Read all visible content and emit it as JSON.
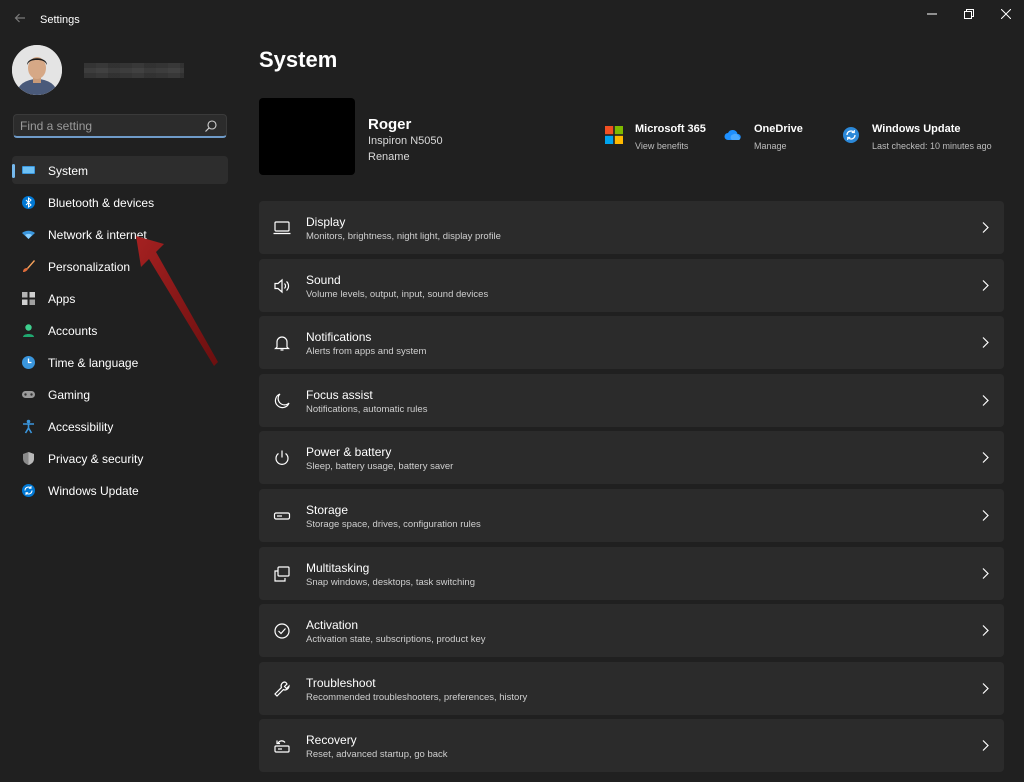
{
  "window": {
    "title": "Settings"
  },
  "profile": {
    "name_redacted": true
  },
  "search": {
    "placeholder": "Find a setting",
    "value": ""
  },
  "sidebar": {
    "items": [
      {
        "label": "System",
        "icon": "system-icon",
        "selected": true
      },
      {
        "label": "Bluetooth & devices",
        "icon": "bluetooth-icon",
        "selected": false
      },
      {
        "label": "Network & internet",
        "icon": "wifi-icon",
        "selected": false
      },
      {
        "label": "Personalization",
        "icon": "brush-icon",
        "selected": false
      },
      {
        "label": "Apps",
        "icon": "apps-icon",
        "selected": false
      },
      {
        "label": "Accounts",
        "icon": "person-icon",
        "selected": false
      },
      {
        "label": "Time & language",
        "icon": "globe-clock-icon",
        "selected": false
      },
      {
        "label": "Gaming",
        "icon": "gamepad-icon",
        "selected": false
      },
      {
        "label": "Accessibility",
        "icon": "accessibility-icon",
        "selected": false
      },
      {
        "label": "Privacy & security",
        "icon": "shield-icon",
        "selected": false
      },
      {
        "label": "Windows Update",
        "icon": "sync-icon",
        "selected": false
      }
    ]
  },
  "main": {
    "title": "System",
    "device": {
      "name": "Roger",
      "model": "Inspiron N5050",
      "rename": "Rename"
    },
    "quick_links": [
      {
        "title": "Microsoft 365",
        "subtitle": "View benefits",
        "icon": "microsoft-logo-icon"
      },
      {
        "title": "OneDrive",
        "subtitle": "Manage",
        "icon": "cloud-icon"
      },
      {
        "title": "Windows Update",
        "subtitle": "Last checked: 10 minutes ago",
        "icon": "update-icon"
      }
    ],
    "cards": [
      {
        "title": "Display",
        "subtitle": "Monitors, brightness, night light, display profile",
        "icon": "monitor-icon"
      },
      {
        "title": "Sound",
        "subtitle": "Volume levels, output, input, sound devices",
        "icon": "speaker-icon"
      },
      {
        "title": "Notifications",
        "subtitle": "Alerts from apps and system",
        "icon": "bell-icon"
      },
      {
        "title": "Focus assist",
        "subtitle": "Notifications, automatic rules",
        "icon": "moon-icon"
      },
      {
        "title": "Power & battery",
        "subtitle": "Sleep, battery usage, battery saver",
        "icon": "power-icon"
      },
      {
        "title": "Storage",
        "subtitle": "Storage space, drives, configuration rules",
        "icon": "drive-icon"
      },
      {
        "title": "Multitasking",
        "subtitle": "Snap windows, desktops, task switching",
        "icon": "multitask-icon"
      },
      {
        "title": "Activation",
        "subtitle": "Activation state, subscriptions, product key",
        "icon": "check-circle-icon"
      },
      {
        "title": "Troubleshoot",
        "subtitle": "Recommended troubleshooters, preferences, history",
        "icon": "wrench-icon"
      },
      {
        "title": "Recovery",
        "subtitle": "Reset, advanced startup, go back",
        "icon": "recovery-icon"
      }
    ]
  },
  "colors": {
    "background": "#202020",
    "card": "#2b2b2b",
    "accent": "#76b9ed",
    "annotation_arrow": "#8b1a1a"
  }
}
